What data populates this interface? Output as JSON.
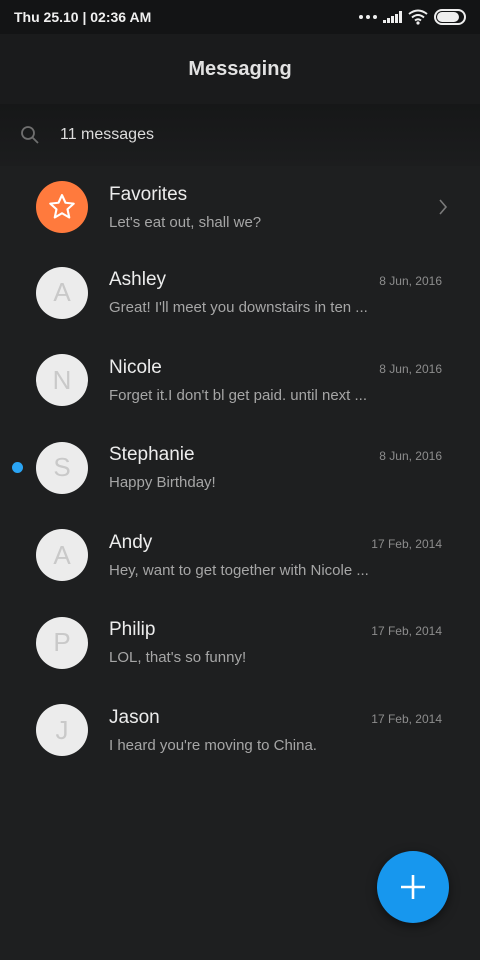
{
  "status_bar": {
    "time": "Thu 25.10 | 02:36 AM",
    "icons": [
      "dots-icon",
      "signal-icon",
      "wifi-icon",
      "battery-icon"
    ],
    "battery_level": 0.85
  },
  "header": {
    "title": "Messaging"
  },
  "search": {
    "placeholder": "11 messages"
  },
  "colors": {
    "accent": "#1797ee",
    "favorites": "#ff7a3d",
    "unread_dot": "#2aa4f4",
    "background": "#1e1f20"
  },
  "conversations": [
    {
      "name": "Favorites",
      "preview": "Let's eat out, shall we?",
      "date": "",
      "avatar": "",
      "favorite": true,
      "unread": false
    },
    {
      "name": "Ashley",
      "preview": "Great! I'll meet you downstairs in ten ...",
      "date": "8 Jun, 2016",
      "avatar": "A",
      "favorite": false,
      "unread": false
    },
    {
      "name": "Nicole",
      "preview": "Forget it.I don't bl get paid. until next ...",
      "date": "8 Jun, 2016",
      "avatar": "N",
      "favorite": false,
      "unread": false
    },
    {
      "name": "Stephanie",
      "preview": "Happy Birthday!",
      "date": "8 Jun, 2016",
      "avatar": "S",
      "favorite": false,
      "unread": true
    },
    {
      "name": "Andy",
      "preview": "Hey, want to get together with Nicole ...",
      "date": "17 Feb, 2014",
      "avatar": "A",
      "favorite": false,
      "unread": false
    },
    {
      "name": "Philip",
      "preview": "LOL, that's so funny!",
      "date": "17 Feb, 2014",
      "avatar": "P",
      "favorite": false,
      "unread": false
    },
    {
      "name": "Jason",
      "preview": "I heard you're moving to China.",
      "date": "17 Feb, 2014",
      "avatar": "J",
      "favorite": false,
      "unread": false
    }
  ],
  "fab": {
    "icon": "plus-icon"
  }
}
